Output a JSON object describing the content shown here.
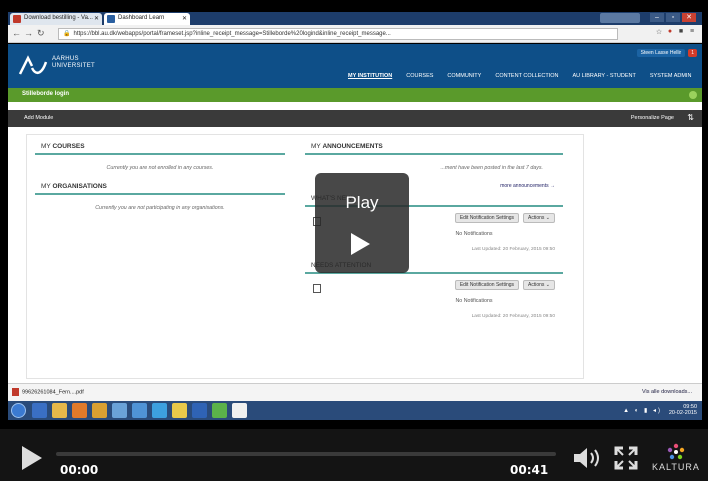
{
  "browser": {
    "tabs": [
      {
        "label": "Download bestilling - Va..."
      },
      {
        "label": "Dashboard Learn"
      }
    ],
    "address": "https://bbl.au.dk/webapps/portal/frameset.jsp?inline_receipt_message=Stilleborde%20logind&inline_receipt_message..."
  },
  "site": {
    "university_name": "AARHUS\nUNIVERSITET",
    "nav": [
      "MY INSTITUTION",
      "COURSES",
      "COMMUNITY",
      "CONTENT COLLECTION",
      "AU LIBRARY - STUDENT",
      "SYSTEM ADMIN"
    ],
    "user_name": "Steen Lasse Hellir",
    "user_badge": "1",
    "green_bar_label": "Stilleborde login",
    "add_module": "Add Module",
    "personalize": "Personalize Page",
    "modules": {
      "courses": {
        "prefix": "MY",
        "title": "COURSES",
        "text": "Currently you are not enrolled in any courses."
      },
      "organisations": {
        "prefix": "MY",
        "title": "ORGANISATIONS",
        "text": "Currently you are not participating in any organisations."
      },
      "announcements": {
        "prefix": "MY",
        "title": "ANNOUNCEMENTS",
        "text": "...ment have been posted in the last 7 days.",
        "link": "more announcements →"
      },
      "whats_new": {
        "title": "WHAT'S NEW",
        "edit": "Edit Notification Settings",
        "actions": "Actions ⌄",
        "notif": "No Notifications",
        "updated": "Last Updated: 20 February, 2015 09:50"
      },
      "needs_attention": {
        "title": "NEEDS ATTENTION",
        "edit": "Edit Notification Settings",
        "actions": "Actions ⌄",
        "notif": "No Notifications",
        "updated": "Last Updated: 20 February, 2015 09:50"
      }
    }
  },
  "overlay": {
    "play_label": "Play"
  },
  "download": {
    "file": "99626261084_Fern....pdf",
    "show_all": "Vis alle downloads..."
  },
  "taskbar": {
    "time": "09:50",
    "date": "20-02-2015"
  },
  "player": {
    "current_time": "00:00",
    "duration": "00:41",
    "brand": "KALTURA",
    "progress_fraction": 0
  }
}
